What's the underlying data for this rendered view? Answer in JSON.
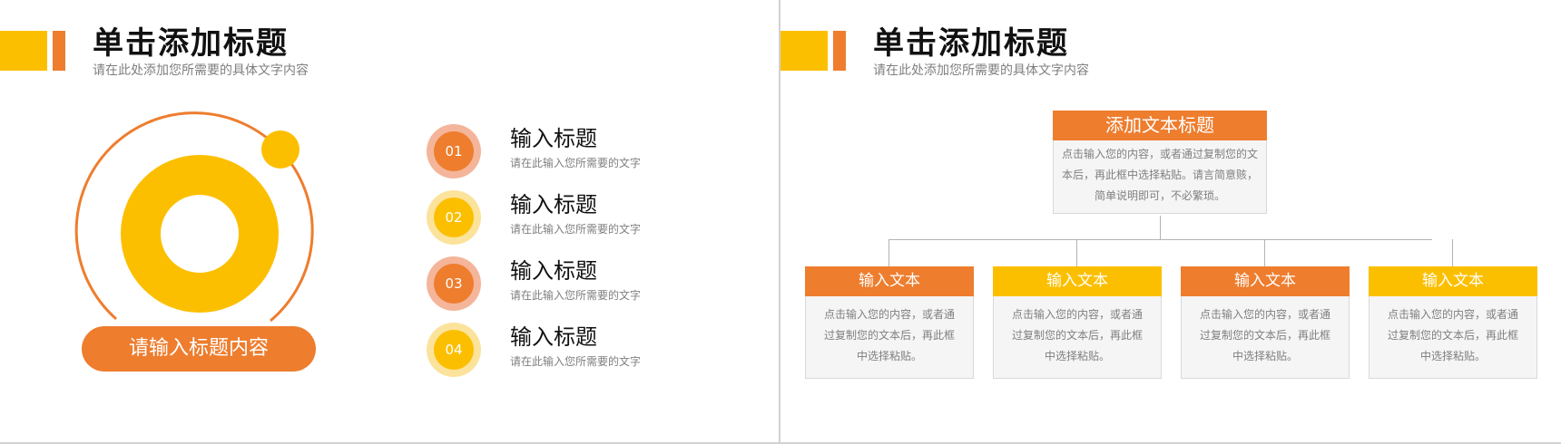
{
  "colors": {
    "orange": "#ee7d2e",
    "yellow": "#fcbf00",
    "light_orange": "#f4b59a",
    "light_yellow": "#fce39b",
    "gray_text": "#7f7f7f"
  },
  "left_slide": {
    "title": "单击添加标题",
    "subtitle": "请在此处添加您所需要的具体文字内容",
    "pill_text": "请输入标题内容",
    "items": [
      {
        "number": "01",
        "title": "输入标题",
        "desc": "请在此输入您所需要的文字",
        "color": "orange"
      },
      {
        "number": "02",
        "title": "输入标题",
        "desc": "请在此输入您所需要的文字",
        "color": "yellow"
      },
      {
        "number": "03",
        "title": "输入标题",
        "desc": "请在此输入您所需要的文字",
        "color": "orange"
      },
      {
        "number": "04",
        "title": "输入标题",
        "desc": "请在此输入您所需要的文字",
        "color": "yellow"
      }
    ]
  },
  "right_slide": {
    "title": "单击添加标题",
    "subtitle": "请在此处添加您所需要的具体文字内容",
    "top_box": {
      "title": "添加文本标题",
      "lines": [
        "点击输入您的内容，或者通过复制您的文",
        "本后，再此框中选择粘贴。请言简意赅，",
        "简单说明即可，不必繁琐。"
      ]
    },
    "children": [
      {
        "title": "输入文本",
        "color": "orange",
        "lines": [
          "点击输入您的内容，或者通",
          "过复制您的文本后，再此框",
          "中选择粘贴。"
        ]
      },
      {
        "title": "输入文本",
        "color": "yellow",
        "lines": [
          "点击输入您的内容，或者通",
          "过复制您的文本后，再此框",
          "中选择粘贴。"
        ]
      },
      {
        "title": "输入文本",
        "color": "orange",
        "lines": [
          "点击输入您的内容，或者通",
          "过复制您的文本后，再此框",
          "中选择粘贴。"
        ]
      },
      {
        "title": "输入文本",
        "color": "yellow",
        "lines": [
          "点击输入您的内容，或者通",
          "过复制您的文本后，再此框",
          "中选择粘贴。"
        ]
      }
    ]
  }
}
